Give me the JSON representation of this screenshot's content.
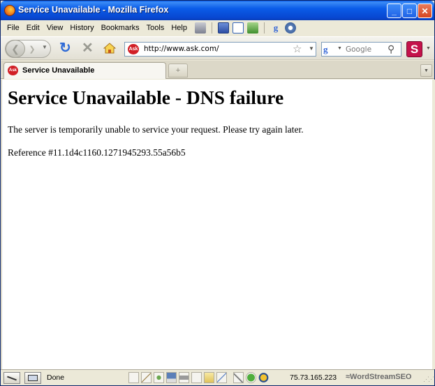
{
  "window": {
    "title": "Service Unavailable - Mozilla Firefox",
    "buttons": {
      "minimize": "_",
      "maximize": "□",
      "close": "✕"
    }
  },
  "menubar": {
    "items": [
      "File",
      "Edit",
      "View",
      "History",
      "Bookmarks",
      "Tools",
      "Help"
    ],
    "toolbar_icons": [
      "printer-icon",
      "bookmark-icon",
      "sidebar-icon",
      "addon-icon",
      "google-icon",
      "settings-icon"
    ]
  },
  "navbar": {
    "url": "http://www.ask.com/",
    "search": {
      "placeholder": "Google",
      "engine_letter": "g"
    },
    "stumble_letter": "S"
  },
  "tabs": [
    {
      "label": "Service Unavailable",
      "active": true
    }
  ],
  "page": {
    "heading": "Service Unavailable - DNS failure",
    "message": "The server is temporarily unable to service your request. Please try again later.",
    "reference": "Reference #11.1d4c1160.1271945293.55a56b5"
  },
  "statusbar": {
    "status": "Done",
    "ip": "75.73.165.223",
    "brand": "WordStreamSEO"
  },
  "favicon": {
    "text": "Ask"
  },
  "colors": {
    "titlebar": "#0a5ce8",
    "close_button": "#d54620",
    "favicon": "#d11f26",
    "stumble": "#c4124b",
    "reload": "#2e6ad6"
  }
}
